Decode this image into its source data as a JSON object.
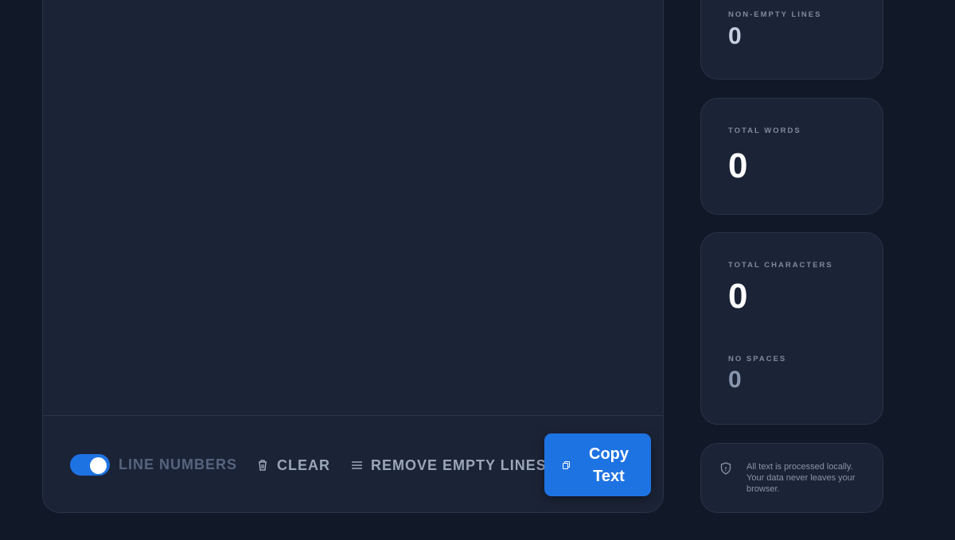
{
  "toolbar": {
    "line_numbers_label": "LINE NUMBERS",
    "line_numbers_enabled": true,
    "clear_label": "CLEAR",
    "remove_empty_label": "REMOVE EMPTY LINES",
    "copy_label": "Copy Text"
  },
  "stats": {
    "non_empty_lines": {
      "label": "NON-EMPTY LINES",
      "value": "0"
    },
    "total_words": {
      "label": "TOTAL WORDS",
      "value": "0"
    },
    "total_characters": {
      "label": "TOTAL CHARACTERS",
      "value": "0"
    },
    "no_spaces": {
      "label": "NO SPACES",
      "value": "0"
    }
  },
  "privacy": {
    "text": "All text is processed locally. Your data never leaves your browser."
  },
  "colors": {
    "background": "#111827",
    "card": "#1b2336",
    "accent": "#1e73e3"
  },
  "icons": [
    "trash-icon",
    "lines-icon",
    "copy-icon",
    "shield-icon"
  ]
}
